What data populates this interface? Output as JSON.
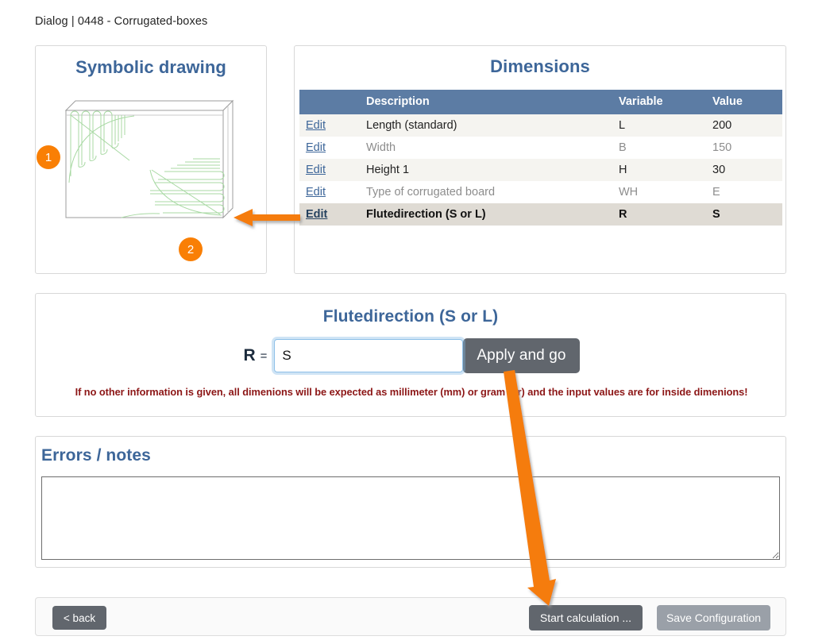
{
  "breadcrumb": "Dialog | 0448 - Corrugated-boxes",
  "colors": {
    "accent_blue": "#3d6699",
    "table_header_blue": "#5c7ca4",
    "selected_row": "#dfdbd4",
    "annotation_orange": "#f97f05",
    "warning_red": "#8c1616",
    "button_gray": "#61666d",
    "button_gray_disabled": "#9aa0a8",
    "drawing_green": "#a8d9a3"
  },
  "drawing_panel": {
    "title": "Symbolic drawing",
    "markers": [
      {
        "label": "1"
      },
      {
        "label": "2"
      }
    ]
  },
  "dimensions_panel": {
    "title": "Dimensions",
    "columns": {
      "edit": "",
      "description": "Description",
      "variable": "Variable",
      "value": "Value"
    },
    "rows": [
      {
        "edit": "Edit",
        "description": "Length (standard)",
        "variable": "L",
        "value": "200",
        "state": "normal",
        "stripe": "odd"
      },
      {
        "edit": "Edit",
        "description": "Width",
        "variable": "B",
        "value": "150",
        "state": "muted",
        "stripe": "even"
      },
      {
        "edit": "Edit",
        "description": "Height 1",
        "variable": "H",
        "value": "30",
        "state": "normal",
        "stripe": "odd"
      },
      {
        "edit": "Edit",
        "description": "Type of corrugated board",
        "variable": "WH",
        "value": "E",
        "state": "muted",
        "stripe": "even"
      },
      {
        "edit": "Edit",
        "description": "Flutedirection (S or L)",
        "variable": "R",
        "value": "S",
        "state": "selected",
        "stripe": "odd"
      }
    ]
  },
  "flute_panel": {
    "title": "Flutedirection (S or L)",
    "variable_label": "R",
    "equals": "=",
    "input_value": "S",
    "input_placeholder": "",
    "apply_button": "Apply and go",
    "warning": "If no other information is given, all dimenions will be expected as millimeter (mm) or gram (gr) and the input values are for inside dimenions!"
  },
  "errors_panel": {
    "title": "Errors / notes",
    "notes_value": "",
    "notes_placeholder": ""
  },
  "footer": {
    "back_button": "< back",
    "start_calculation_button": "Start calculation ...",
    "save_configuration_button": "Save Configuration"
  }
}
